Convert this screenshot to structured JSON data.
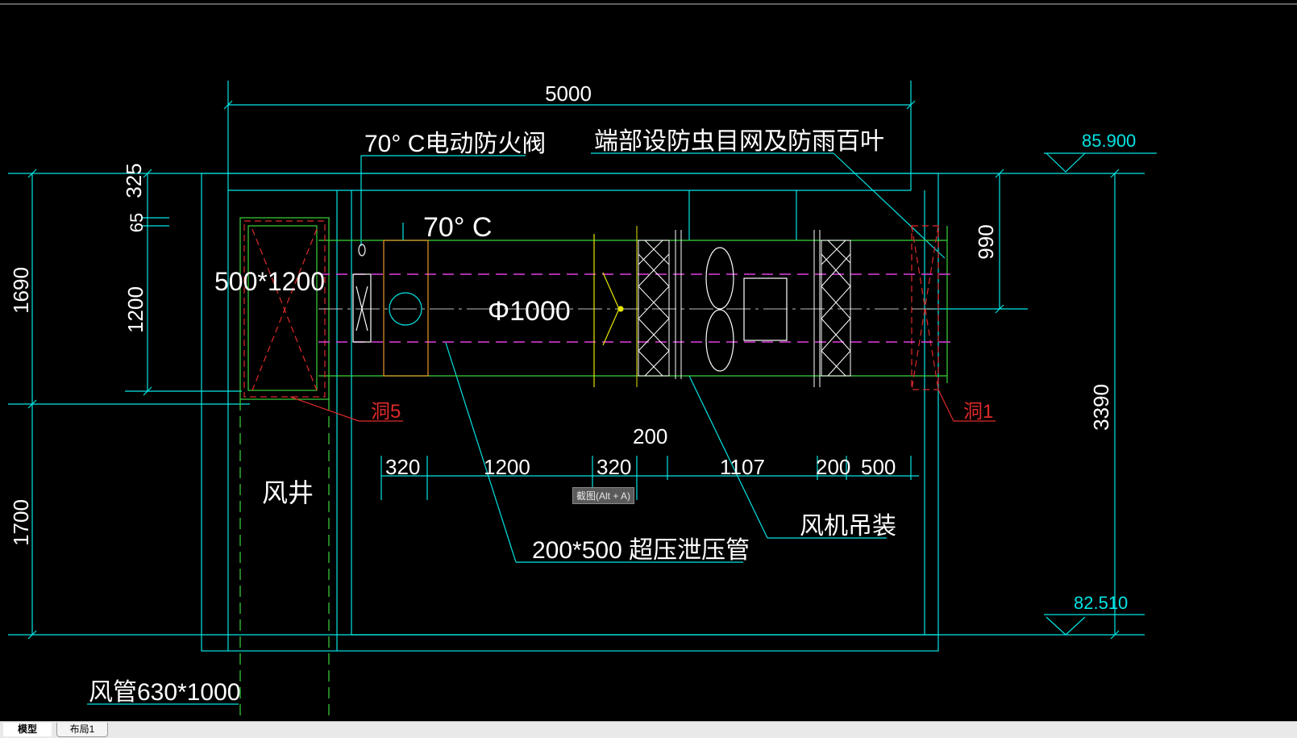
{
  "drawing": {
    "dimensions": {
      "overall_width": "5000",
      "left_1690": "1690",
      "left_1700": "1700",
      "dim_325": "325",
      "dim_65": "65",
      "dim_1200": "1200",
      "right_990": "990",
      "right_3390": "3390",
      "dim_200": "200",
      "seg_320_a": "320",
      "seg_1200": "1200",
      "seg_320_b": "320",
      "seg_1107": "1107",
      "seg_200": "200",
      "seg_500": "500"
    },
    "elevations": {
      "top": "85.900",
      "bottom": "82.510"
    },
    "labels": {
      "fire_damper": "70° C电动防火阀",
      "end_screen": "端部设防虫目网及防雨百叶",
      "damper_70c": "70° C",
      "opening_500x1200": "500*1200",
      "duct_diameter": "Φ1000",
      "hole5": "洞5",
      "hole1": "洞1",
      "air_shaft": "风井",
      "relief_pipe": "200*500  超压泄压管",
      "fan_hanging": "风机吊装",
      "duct_630x1000": "风管630*1000"
    },
    "colors": {
      "background": "#000000",
      "cyan": "#00e5e5",
      "green": "#39d63b",
      "yellow": "#e8e800",
      "orange": "#e89a2a",
      "red": "#e02a2a",
      "magenta": "#e03fe0",
      "white": "#ffffff",
      "grey": "#c0c0c0"
    }
  },
  "tooltip": {
    "text": "截图(Alt + A)"
  },
  "tabs": [
    {
      "label": "模型",
      "active": true
    },
    {
      "label": "布局1",
      "active": false
    }
  ]
}
